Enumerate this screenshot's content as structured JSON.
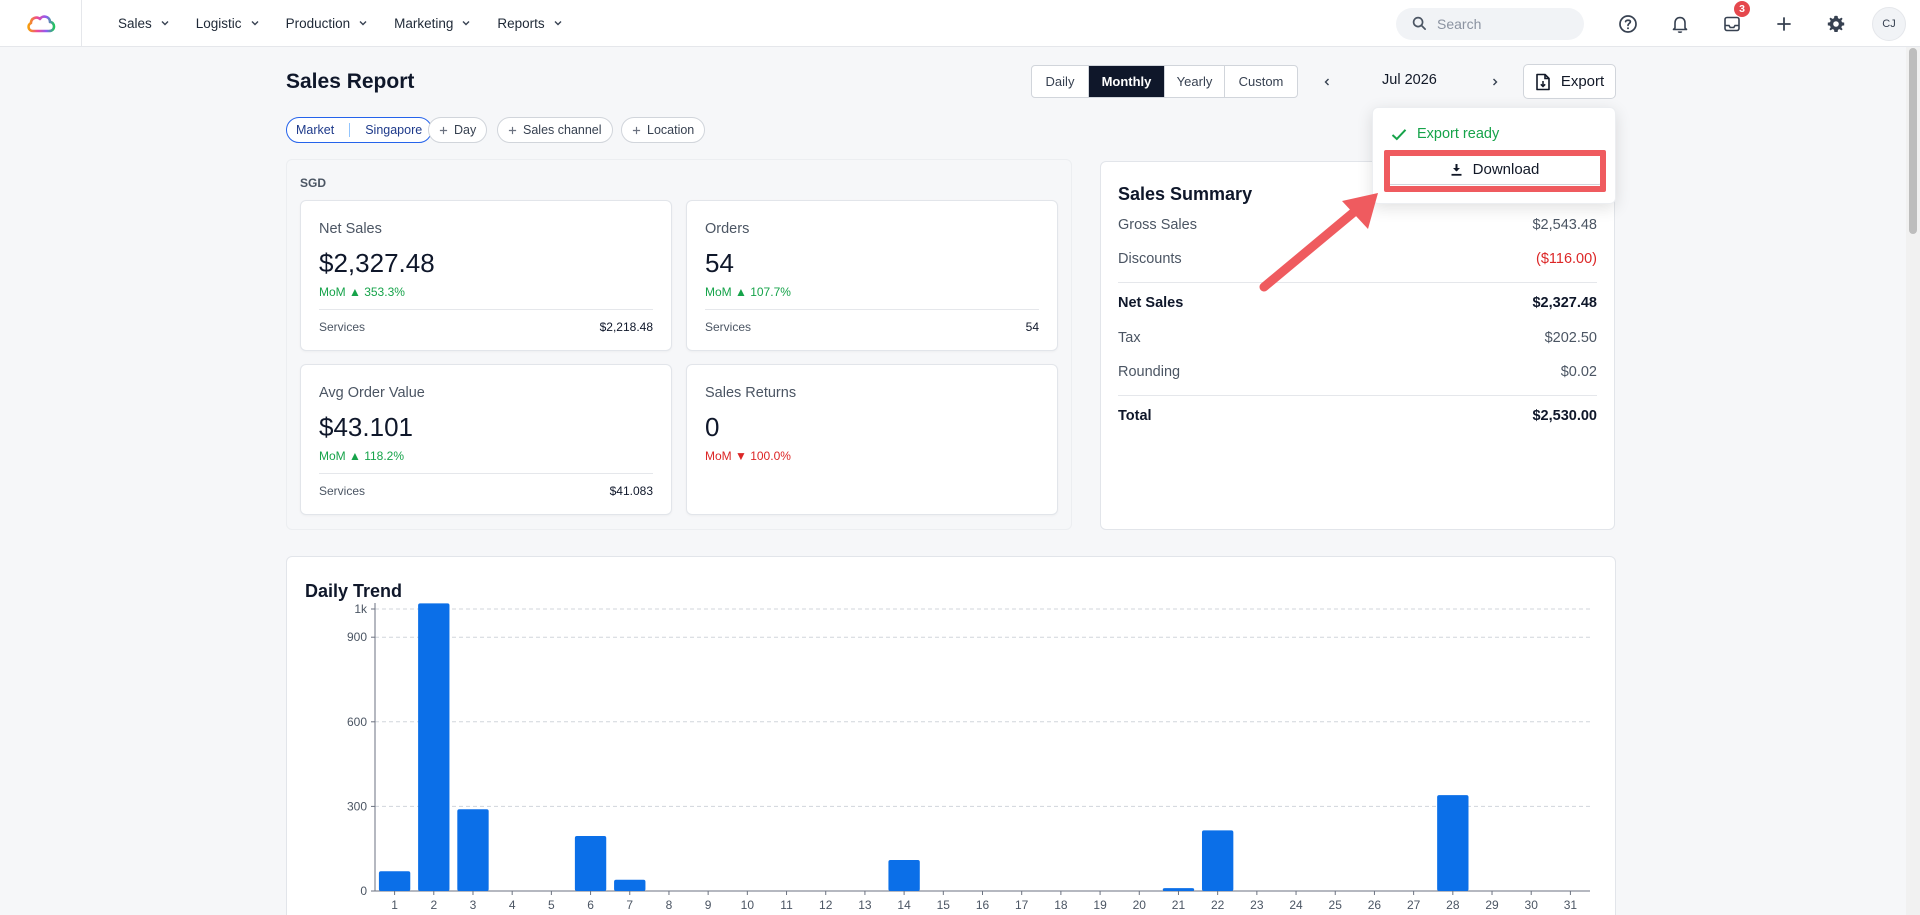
{
  "nav": {
    "items": [
      {
        "label": "Sales"
      },
      {
        "label": "Logistic"
      },
      {
        "label": "Production"
      },
      {
        "label": "Marketing"
      },
      {
        "label": "Reports"
      }
    ],
    "search_placeholder": "Search",
    "inbox_badge": "3",
    "avatar_initials": "CJ"
  },
  "header": {
    "title": "Sales Report",
    "periods": [
      "Daily",
      "Monthly",
      "Yearly",
      "Custom"
    ],
    "active_period": "Monthly",
    "current_period": "Jul 2026",
    "export_label": "Export"
  },
  "filters": {
    "market_label": "Market",
    "market_value": "Singapore",
    "add_day": "Day",
    "add_channel": "Sales channel",
    "add_location": "Location"
  },
  "kpis": {
    "currency": "SGD",
    "cards": [
      {
        "label": "Net Sales",
        "value": "$2,327.48",
        "mom": "MoM ▲ 353.3%",
        "trend": "up",
        "sub_label": "Services",
        "sub_value": "$2,218.48"
      },
      {
        "label": "Orders",
        "value": "54",
        "mom": "MoM ▲ 107.7%",
        "trend": "up",
        "sub_label": "Services",
        "sub_value": "54"
      },
      {
        "label": "Avg Order Value",
        "value": "$43.101",
        "mom": "MoM ▲ 118.2%",
        "trend": "up",
        "sub_label": "Services",
        "sub_value": "$41.083"
      },
      {
        "label": "Sales Returns",
        "value": "0",
        "mom": "MoM ▼ 100.0%",
        "trend": "down"
      }
    ]
  },
  "summary": {
    "title": "Sales Summary",
    "rows": [
      {
        "label": "Gross Sales",
        "value": "$2,543.48"
      },
      {
        "label": "Discounts",
        "value": "($116.00)"
      },
      {
        "label": "Net Sales",
        "value": "$2,327.48"
      },
      {
        "label": "Tax",
        "value": "$202.50"
      },
      {
        "label": "Rounding",
        "value": "$0.02"
      },
      {
        "label": "Total",
        "value": "$2,530.00"
      }
    ]
  },
  "export_popover": {
    "status": "Export ready",
    "download_label": "Download"
  },
  "colors": {
    "accent": "#0f172a",
    "bar": "#0b6fe8",
    "positive": "#16a34a",
    "negative": "#dc2626",
    "highlight": "#ef5b5f"
  },
  "chart_data": {
    "type": "bar",
    "title": "Daily Trend",
    "xlabel": "",
    "ylabel": "",
    "categories": [
      "1",
      "2",
      "3",
      "4",
      "5",
      "6",
      "7",
      "8",
      "9",
      "10",
      "11",
      "12",
      "13",
      "14",
      "15",
      "16",
      "17",
      "18",
      "19",
      "20",
      "21",
      "22",
      "23",
      "24",
      "25",
      "26",
      "27",
      "28",
      "29",
      "30",
      "31"
    ],
    "values": [
      70,
      1020,
      290,
      0,
      0,
      195,
      40,
      0,
      0,
      0,
      0,
      0,
      0,
      110,
      0,
      0,
      0,
      0,
      0,
      0,
      10,
      215,
      0,
      0,
      0,
      0,
      0,
      340,
      0,
      0,
      0
    ],
    "yticks": [
      0,
      300,
      600,
      900,
      1000
    ],
    "ytick_labels": [
      "0",
      "300",
      "600",
      "900",
      "1k"
    ],
    "ylim": [
      0,
      1000
    ],
    "grid": true
  }
}
